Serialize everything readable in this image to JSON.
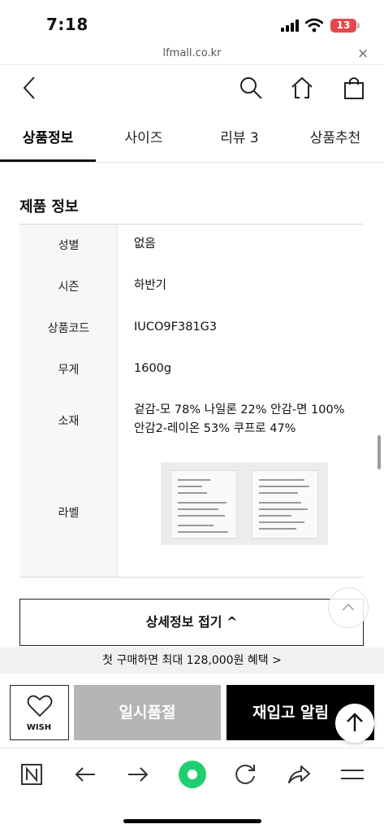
{
  "status_bar": {
    "time": "7:18",
    "battery": "13"
  },
  "browser": {
    "url": "lfmall.co.kr",
    "close_glyph": "×"
  },
  "nav": {
    "back_icon": "chevron-left-icon",
    "search_icon": "search-icon",
    "home_icon": "home-icon",
    "bag_icon": "shopping-bag-icon"
  },
  "tabs": [
    {
      "label": "상품정보",
      "active": true
    },
    {
      "label": "사이즈",
      "active": false
    },
    {
      "label": "리뷰 3",
      "active": false
    },
    {
      "label": "상품추천",
      "active": false
    }
  ],
  "section": {
    "title": "제품 정보"
  },
  "product_info": {
    "rows": [
      {
        "label": "성별",
        "value": "없음"
      },
      {
        "label": "시즌",
        "value": "하반기"
      },
      {
        "label": "상품코드",
        "value": "IUCO9F381G3"
      },
      {
        "label": "무게",
        "value": "1600g"
      },
      {
        "label": "소재",
        "value_lines": [
          "겉감-모 78% 나일론 22% 안감-면 100%",
          "안감2-레이온 53% 쿠프로 47%"
        ]
      },
      {
        "label": "라벨",
        "image": "care-label-photos"
      }
    ]
  },
  "collapse_button": {
    "label": "상세정보 접기 ^"
  },
  "promo": {
    "text": "첫 구매하면 최대 128,000원 혜택 >"
  },
  "purchase_bar": {
    "wish_label": "WISH",
    "soldout_label": "일시품절",
    "restock_label": "재입고 알림"
  },
  "colors": {
    "accent_green": "#1fcf6f",
    "soldout_gray": "#b5b5b5",
    "battery_red": "#e5484d"
  }
}
